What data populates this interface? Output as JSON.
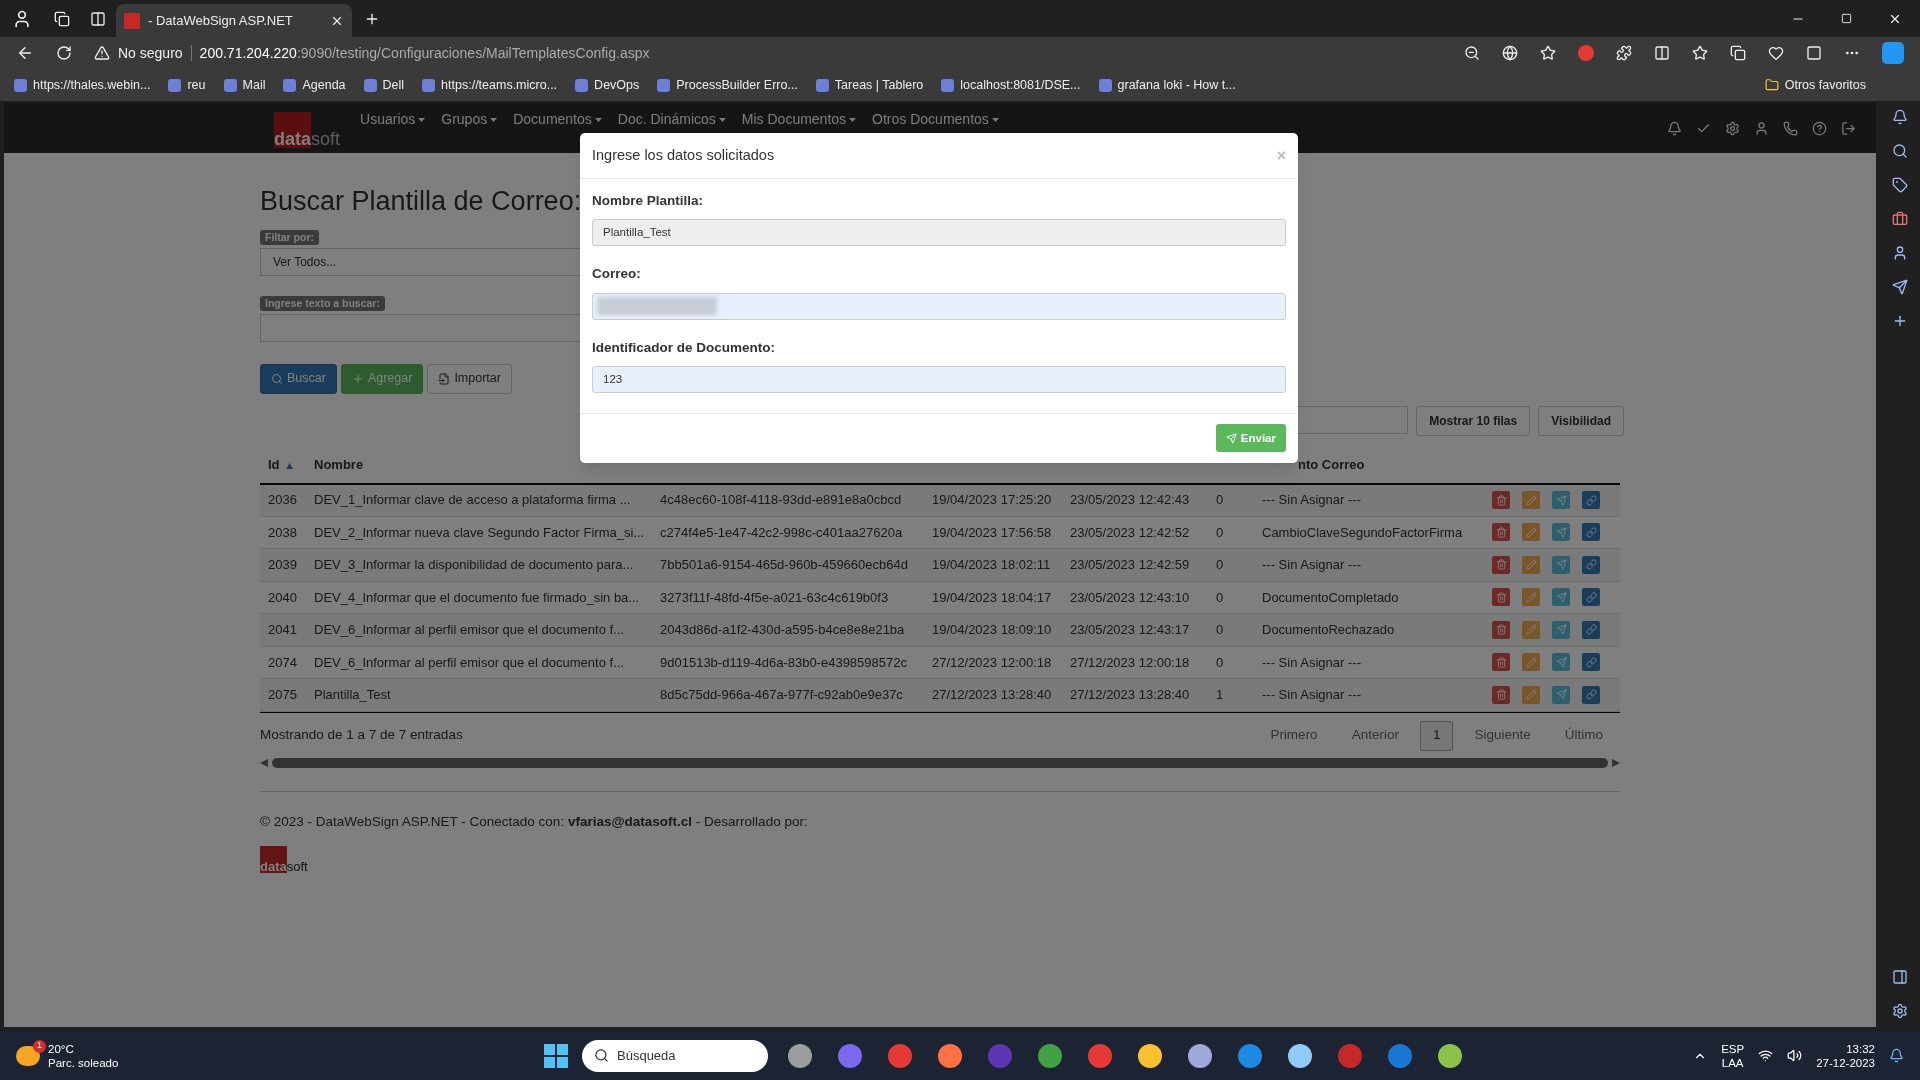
{
  "browser": {
    "tab_title": "- DataWebSign ASP.NET",
    "security": "No seguro",
    "url_host": "200.71.204.220",
    "url_path": ":9090/testing/Configuraciones/MailTemplatesConfig.aspx",
    "bookmarks": [
      "https://thales.webin...",
      "reu",
      "Mail",
      "Agenda",
      "Dell",
      "https://teams.micro...",
      "DevOps",
      "ProcessBuilder Erro...",
      "Tareas | Tablero",
      "localhost:8081/DSE...",
      "grafana loki - How t..."
    ],
    "other_favorites": "Otros favoritos"
  },
  "navbar": {
    "logo_bold": "data",
    "logo_light": "soft",
    "menus": [
      "Usuarios",
      "Grupos",
      "Documentos",
      "Doc. Dinámicos",
      "Mis Documentos",
      "Otros Documentos"
    ]
  },
  "page": {
    "title": "Buscar Plantilla de Correo:",
    "filter_label": "Filtar por:",
    "filter_value": "Ver Todos...",
    "search_label": "Ingrese texto a buscar:",
    "buttons": [
      {
        "kind": "search",
        "label": "Buscar"
      },
      {
        "kind": "add",
        "label": "Agregar"
      },
      {
        "kind": "import",
        "label": "Importar"
      }
    ],
    "table_buttons": [
      "Mostrar 10 filas",
      "Visibilidad"
    ]
  },
  "table": {
    "columns": [
      "Id",
      "Nombre",
      "",
      "",
      "",
      "",
      "nto Correo"
    ],
    "rows": [
      [
        "2036",
        "DEV_1_Informar clave de acceso a plataforma firma ...",
        "4c48ec60-108f-4118-93dd-e891e8a0cbcd",
        "19/04/2023 17:25:20",
        "23/05/2023 12:42:43",
        "0",
        "--- Sin Asignar ---"
      ],
      [
        "2038",
        "DEV_2_Informar nueva clave Segundo Factor Firma_si...",
        "c274f4e5-1e47-42c2-998c-c401aa27620a",
        "19/04/2023 17:56:58",
        "23/05/2023 12:42:52",
        "0",
        "CambioClaveSegundoFactorFirma"
      ],
      [
        "2039",
        "DEV_3_Informar la disponibilidad de documento para...",
        "7bb501a6-9154-465d-960b-459660ecb64d",
        "19/04/2023 18:02:11",
        "23/05/2023 12:42:59",
        "0",
        "--- Sin Asignar ---"
      ],
      [
        "2040",
        "DEV_4_Informar que el documento fue firmado_sin ba...",
        "3273f11f-48fd-4f5e-a021-63c4c619b0f3",
        "19/04/2023 18:04:17",
        "23/05/2023 12:43:10",
        "0",
        "DocumentoCompletado"
      ],
      [
        "2041",
        "DEV_6_Informar al perfil emisor que el documento f...",
        "2043d86d-a1f2-430d-a595-b4ce8e8e21ba",
        "19/04/2023 18:09:10",
        "23/05/2023 12:43:17",
        "0",
        "DocumentoRechazado"
      ],
      [
        "2074",
        "DEV_6_Informar al perfil emisor que el documento f...",
        "9d01513b-d119-4d6a-83b0-e4398598572c",
        "27/12/2023 12:00:18",
        "27/12/2023 12:00:18",
        "0",
        "--- Sin Asignar ---"
      ],
      [
        "2075",
        "Plantilla_Test",
        "8d5c75dd-966a-467a-977f-c92ab0e9e37c",
        "27/12/2023 13:28:40",
        "27/12/2023 13:28:40",
        "1",
        "--- Sin Asignar ---"
      ]
    ],
    "info": "Mostrando de 1 a 7 de 7 entradas",
    "pagination": [
      {
        "label": "Primero",
        "selected": false
      },
      {
        "label": "Anterior",
        "selected": false
      },
      {
        "label": "1",
        "selected": true
      },
      {
        "label": "Siguiente",
        "selected": false
      },
      {
        "label": "Último",
        "selected": false
      }
    ]
  },
  "footer": {
    "text": "© 2023 - DataWebSign ASP.NET - Conectado con: **vfarias@datasoft.cl** - Desarrollado por:",
    "logo_bold": "data",
    "logo_light": "soft"
  },
  "modal": {
    "title": "Ingrese los datos solicitados",
    "close": "×",
    "fields": [
      {
        "label": "Nombre Plantilla:",
        "value": "Plantilla_Test",
        "readonly": true,
        "redacted": false
      },
      {
        "label": "Correo:",
        "readonly": false,
        "redacted": true
      },
      {
        "label": "Identificador de Documento:",
        "value": "123",
        "readonly": false,
        "redacted": false
      }
    ],
    "submit": "Enviar"
  },
  "taskbar": {
    "weather_temp": "20°C",
    "weather_text": "Parc. soleado",
    "weather_badge": "1",
    "search_placeholder": "Búsqueda",
    "lang": "ESP",
    "layout": "LAA",
    "time": "13:32",
    "date": "27-12-2023"
  }
}
